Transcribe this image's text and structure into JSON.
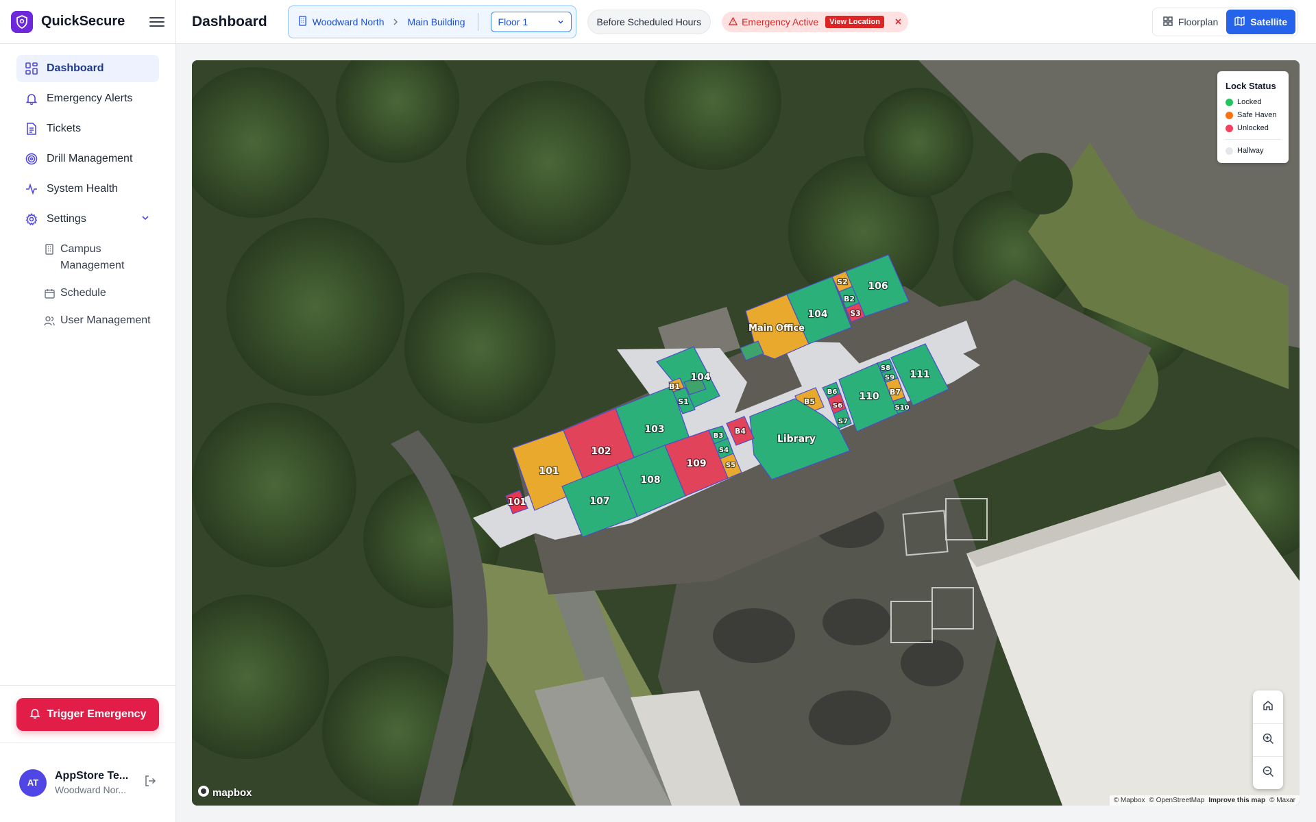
{
  "app": {
    "name": "QuickSecure"
  },
  "header": {
    "title": "Dashboard",
    "breadcrumb": {
      "campus": "Woodward North",
      "building": "Main Building"
    },
    "floor_select": {
      "value": "Floor 1"
    },
    "schedule_status": "Before Scheduled Hours",
    "emergency": {
      "label": "Emergency Active",
      "view_location": "View Location",
      "close_icon": "x-icon"
    },
    "view_toggle": {
      "floorplan": "Floorplan",
      "satellite": "Satellite",
      "active": "Satellite"
    }
  },
  "sidebar": {
    "items": [
      {
        "label": "Dashboard",
        "icon": "dashboard-icon",
        "active": true
      },
      {
        "label": "Emergency Alerts",
        "icon": "bell-icon"
      },
      {
        "label": "Tickets",
        "icon": "document-icon"
      },
      {
        "label": "Drill Management",
        "icon": "target-icon"
      },
      {
        "label": "System Health",
        "icon": "activity-icon"
      },
      {
        "label": "Settings",
        "icon": "gear-icon"
      }
    ],
    "settings_children": [
      {
        "label": "Campus Management",
        "icon": "building-icon"
      },
      {
        "label": "Schedule",
        "icon": "calendar-icon"
      },
      {
        "label": "User Management",
        "icon": "users-icon"
      }
    ],
    "trigger_button": "Trigger Emergency",
    "user": {
      "initials": "AT",
      "name": "AppStore Te...",
      "org": "Woodward Nor..."
    }
  },
  "legend": {
    "title": "Lock Status",
    "items": [
      {
        "label": "Locked",
        "color": "#22c55e"
      },
      {
        "label": "Safe Haven",
        "color": "#f97316"
      },
      {
        "label": "Unlocked",
        "color": "#f43f5e"
      },
      {
        "label": "Hallway",
        "color": "#e5e7eb"
      }
    ]
  },
  "rooms": {
    "r101": "101",
    "r101b": "101",
    "r102": "102",
    "r103": "103",
    "r104a": "104",
    "r104b": "104",
    "r106": "106",
    "r107": "107",
    "r108": "108",
    "r109": "109",
    "r110": "110",
    "r111": "111",
    "main_office": "Main Office",
    "library": "Library",
    "b1": "B1",
    "b2": "B2",
    "b3": "B3",
    "b4": "B4",
    "b5": "B5",
    "b6": "B6",
    "b7": "B7",
    "s1": "S1",
    "s2": "S2",
    "s3": "S3",
    "s4": "S4",
    "s5": "S5",
    "s6": "S6",
    "s7": "S7",
    "s8": "S8",
    "s9": "S9",
    "s10": "S10"
  },
  "map": {
    "brand": "mapbox",
    "attribution": {
      "mapbox": "© Mapbox",
      "osm": "© OpenStreetMap",
      "improve": "Improve this map",
      "maxar": "© Maxar"
    }
  }
}
